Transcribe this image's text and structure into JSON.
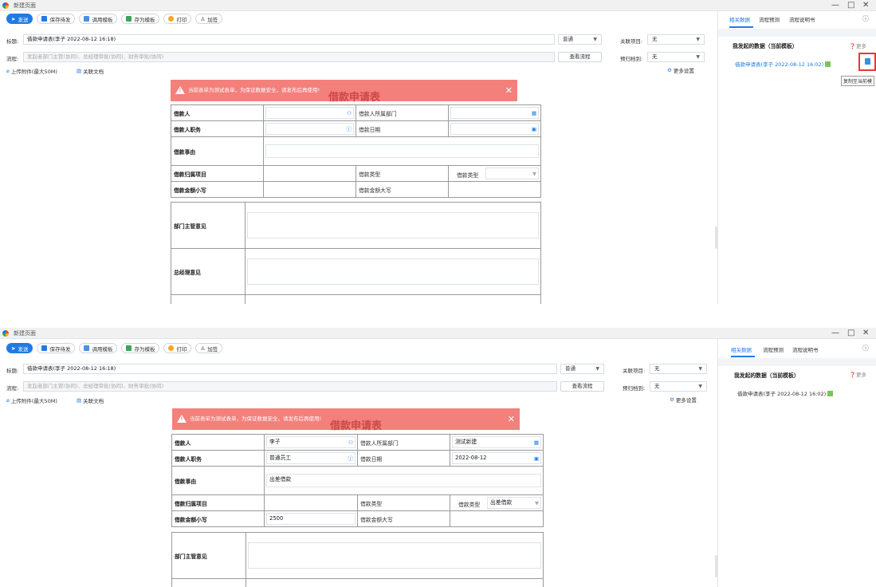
{
  "window": {
    "title": "新建页面",
    "minimize": "—",
    "maximize": "□",
    "close": "✕"
  },
  "toolbar": {
    "send": "发送",
    "save_draft": "保存待发",
    "call_template": "调用模板",
    "save_template": "存为模板",
    "print": "打印",
    "add_sign": "加签"
  },
  "header": {
    "subject_label": "标题:",
    "subject_value": "借款申请表(李子 2022-08-12 16:18)",
    "priority": "普通",
    "related_project_label": "关联项目:",
    "related_project_value": "无",
    "flow_label": "流程:",
    "flow_placeholder": "发起者部门主管(协同)、总经理审批(协同)、财务审批(协同)",
    "view_flow": "查看流程",
    "archive_label": "预归档到:",
    "archive_value": "无",
    "upload": "上传附件(最大50M)",
    "related_doc": "关联文档",
    "more_settings": "更多设置"
  },
  "banner": {
    "text": "当前表单为测试表单，为保证数据安全，请发布后再使用!",
    "close": "✕"
  },
  "form": {
    "title": "借款申请表",
    "borrower": "借款人",
    "borrower_dept": "借款人所属部门",
    "borrower_position": "借款人职务",
    "borrow_date": "借款日期",
    "reason": "借款事由",
    "project": "借款归属项目",
    "loan_type_label": "借款类型",
    "loan_type_label2": "借款类型",
    "amount_small": "借款金额小写",
    "amount_big": "借款金额大写",
    "dept_opinion": "部门主管意见",
    "gm_opinion": "总经理意见"
  },
  "filled": {
    "borrower": "李子",
    "dept": "测试新建",
    "position": "普通员工",
    "date": "2022-08-12",
    "reason": "出差借款",
    "loan_type": "出差借款",
    "amount": "2500"
  },
  "side": {
    "tab_related": "相关数据",
    "tab_predict": "流程预测",
    "tab_desc": "流程说明书",
    "section": "我发起的数据（当前模板）",
    "more": "更多",
    "item": "借款申请表(李子 2022-08-12 16:02)",
    "tooltip": "复制至当前模"
  },
  "colors": {
    "accent": "#1e7be6",
    "banner": "#f4807b",
    "highlight": "#e53935"
  }
}
